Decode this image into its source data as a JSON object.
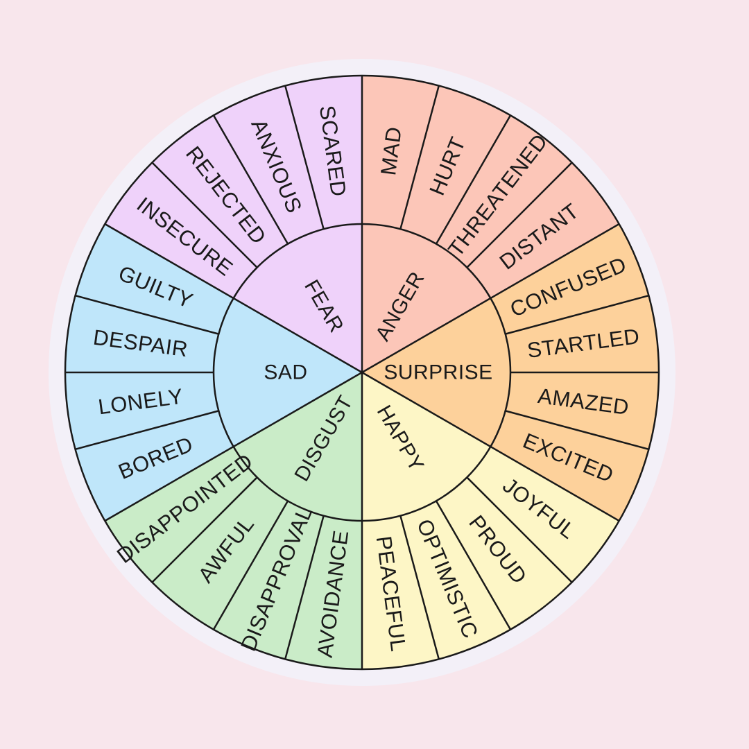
{
  "wheel": {
    "background": "#f8e6ec",
    "halo_color": "#f3f0f8",
    "core_emotions": [
      {
        "label": "FEAR",
        "color": "#efd2fa",
        "feelings": [
          "INSECURE",
          "REJECTED",
          "ANXIOUS",
          "SCARED"
        ]
      },
      {
        "label": "ANGER",
        "color": "#fcc6b8",
        "feelings": [
          "MAD",
          "HURT",
          "THREATENED",
          "DISTANT"
        ]
      },
      {
        "label": "SURPRISE",
        "color": "#fdd19b",
        "feelings": [
          "CONFUSED",
          "STARTLED",
          "AMAZED",
          "EXCITED"
        ]
      },
      {
        "label": "HAPPY",
        "color": "#fdf6c6",
        "feelings": [
          "JOYFUL",
          "PROUD",
          "OPTIMISTIC",
          "PEACEFUL"
        ]
      },
      {
        "label": "DISGUST",
        "color": "#caecc8",
        "feelings": [
          "AVOIDANCE",
          "DISAPPROVAL",
          "AWFUL",
          "DISAPPOINTED"
        ]
      },
      {
        "label": "SAD",
        "color": "#bfe6fa",
        "feelings": [
          "BORED",
          "LONELY",
          "DESPAIR",
          "GUILTY"
        ]
      }
    ]
  }
}
